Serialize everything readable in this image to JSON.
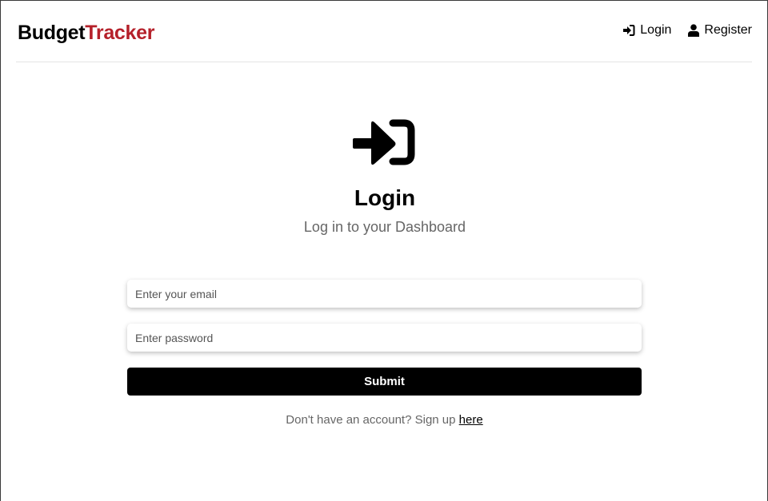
{
  "brand": {
    "name_part1": "Budget",
    "name_part2": "Tracker",
    "accent_color": "#b5202a"
  },
  "nav": {
    "login_label": "Login",
    "login_icon": "sign-in-icon",
    "register_label": "Register",
    "register_icon": "user-icon"
  },
  "hero": {
    "icon": "sign-in-icon",
    "title": "Login",
    "subtitle": "Log in to your Dashboard"
  },
  "form": {
    "email": {
      "value": "",
      "placeholder": "Enter your email"
    },
    "password": {
      "value": "",
      "placeholder": "Enter password"
    },
    "submit_label": "Submit"
  },
  "signup": {
    "prompt": "Don't have an account? Sign up ",
    "link_label": "here"
  }
}
